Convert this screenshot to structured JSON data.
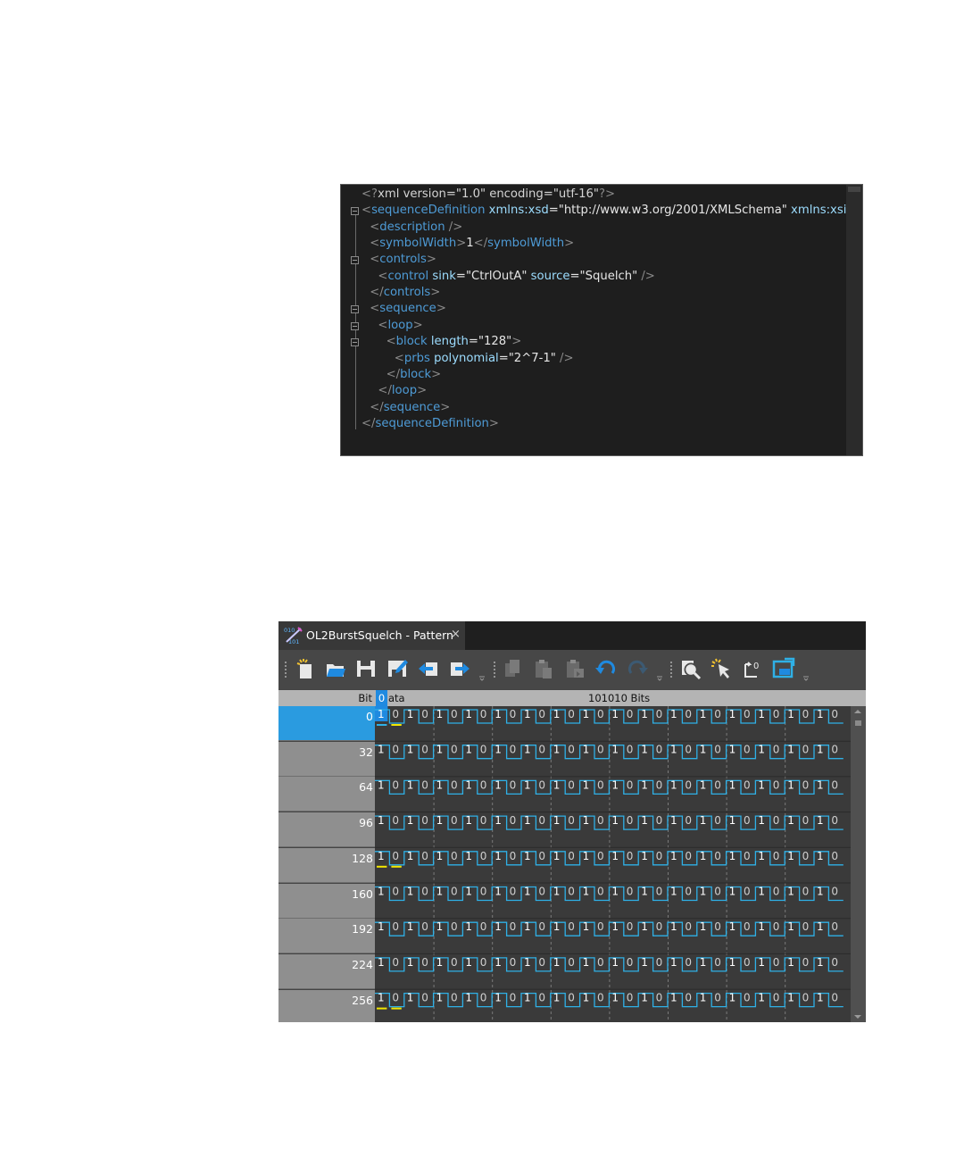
{
  "xml_editor": {
    "lines": [
      {
        "fold": false,
        "indent": 0,
        "tokens": [
          [
            "punc",
            "<?"
          ],
          [
            "pi",
            "xml version=\"1.0\" encoding=\"utf-16\""
          ],
          [
            "punc",
            "?>"
          ]
        ]
      },
      {
        "fold": true,
        "indent": 0,
        "tokens": [
          [
            "punc",
            "<"
          ],
          [
            "tag",
            "sequenceDefinition"
          ],
          [
            "attr",
            " xmlns:xsd"
          ],
          [
            "val",
            "=\"http://www.w3.org/2001/XMLSchema\""
          ],
          [
            "attr",
            " xmlns:xsi"
          ]
        ]
      },
      {
        "fold": false,
        "indent": 1,
        "tokens": [
          [
            "punc",
            "<"
          ],
          [
            "tag",
            "description"
          ],
          [
            "punc",
            " />"
          ]
        ]
      },
      {
        "fold": false,
        "indent": 1,
        "tokens": [
          [
            "punc",
            "<"
          ],
          [
            "tag",
            "symbolWidth"
          ],
          [
            "punc",
            ">"
          ],
          [
            "txt",
            "1"
          ],
          [
            "punc",
            "</"
          ],
          [
            "tag",
            "symbolWidth"
          ],
          [
            "punc",
            ">"
          ]
        ]
      },
      {
        "fold": true,
        "indent": 1,
        "tokens": [
          [
            "punc",
            "<"
          ],
          [
            "tag",
            "controls"
          ],
          [
            "punc",
            ">"
          ]
        ]
      },
      {
        "fold": false,
        "indent": 2,
        "tokens": [
          [
            "punc",
            "<"
          ],
          [
            "tag",
            "control"
          ],
          [
            "attr",
            " sink"
          ],
          [
            "val",
            "=\"CtrlOutA\""
          ],
          [
            "attr",
            " source"
          ],
          [
            "val",
            "=\"Squelch\""
          ],
          [
            "punc",
            " />"
          ]
        ]
      },
      {
        "fold": false,
        "indent": 1,
        "tokens": [
          [
            "punc",
            "</"
          ],
          [
            "tag",
            "controls"
          ],
          [
            "punc",
            ">"
          ]
        ]
      },
      {
        "fold": true,
        "indent": 1,
        "tokens": [
          [
            "punc",
            "<"
          ],
          [
            "tag",
            "sequence"
          ],
          [
            "punc",
            ">"
          ]
        ]
      },
      {
        "fold": true,
        "indent": 2,
        "tokens": [
          [
            "punc",
            "<"
          ],
          [
            "tag",
            "loop"
          ],
          [
            "punc",
            ">"
          ]
        ]
      },
      {
        "fold": true,
        "indent": 3,
        "tokens": [
          [
            "punc",
            "<"
          ],
          [
            "tag",
            "block"
          ],
          [
            "attr",
            " length"
          ],
          [
            "val",
            "=\"128\""
          ],
          [
            "punc",
            ">"
          ]
        ]
      },
      {
        "fold": false,
        "indent": 4,
        "tokens": [
          [
            "punc",
            "<"
          ],
          [
            "tag",
            "prbs"
          ],
          [
            "attr",
            " polynomial"
          ],
          [
            "val",
            "=\"2^7-1\""
          ],
          [
            "punc",
            " />"
          ]
        ]
      },
      {
        "fold": false,
        "indent": 3,
        "tokens": [
          [
            "punc",
            "</"
          ],
          [
            "tag",
            "block"
          ],
          [
            "punc",
            ">"
          ]
        ]
      },
      {
        "fold": false,
        "indent": 2,
        "tokens": [
          [
            "punc",
            "</"
          ],
          [
            "tag",
            "loop"
          ],
          [
            "punc",
            ">"
          ]
        ]
      },
      {
        "fold": false,
        "indent": 1,
        "tokens": [
          [
            "punc",
            "</"
          ],
          [
            "tag",
            "sequence"
          ],
          [
            "punc",
            ">"
          ]
        ]
      },
      {
        "fold": false,
        "indent": 0,
        "tokens": [
          [
            "punc",
            "</"
          ],
          [
            "tag",
            "sequenceDefinition"
          ],
          [
            "punc",
            ">"
          ]
        ]
      }
    ]
  },
  "pattern_editor": {
    "tab": {
      "title": "OL2BurstSquelch - Pattern",
      "close": "×",
      "icon": "pattern-file-icon"
    },
    "toolbar": {
      "buttons": [
        {
          "name": "new-icon",
          "enabled": true
        },
        {
          "name": "open-icon",
          "enabled": true
        },
        {
          "name": "save-icon",
          "enabled": true
        },
        {
          "name": "save-as-icon",
          "enabled": true
        },
        {
          "name": "import-icon",
          "enabled": true
        },
        {
          "name": "export-icon",
          "enabled": true
        },
        {
          "name": "copy-icon",
          "enabled": false
        },
        {
          "name": "paste-icon",
          "enabled": false
        },
        {
          "name": "paste-special-icon",
          "enabled": false
        },
        {
          "name": "undo-icon",
          "enabled": true
        },
        {
          "name": "redo-icon",
          "enabled": false
        },
        {
          "name": "find-icon",
          "enabled": true
        },
        {
          "name": "select-icon",
          "enabled": true
        },
        {
          "name": "goto-bit-icon",
          "enabled": true
        },
        {
          "name": "binary-view-icon",
          "enabled": true
        }
      ]
    },
    "header": {
      "bit_label": "Bit",
      "data_cursor": "0",
      "data_label": "ata",
      "bits_summary": "101010 Bits"
    },
    "rows": [
      {
        "offset": "0",
        "selected": true,
        "marks": [
          0,
          1
        ]
      },
      {
        "offset": "32",
        "selected": false,
        "marks": []
      },
      {
        "offset": "64",
        "selected": false,
        "marks": []
      },
      {
        "offset": "96",
        "selected": false,
        "marks": []
      },
      {
        "offset": "128",
        "selected": false,
        "marks": [
          0,
          1
        ]
      },
      {
        "offset": "160",
        "selected": false,
        "marks": []
      },
      {
        "offset": "192",
        "selected": false,
        "marks": []
      },
      {
        "offset": "224",
        "selected": false,
        "marks": []
      },
      {
        "offset": "256",
        "selected": false,
        "marks": [
          0,
          1
        ]
      }
    ],
    "row_bits": "10101010101010101010101010101010",
    "colors": {
      "waveform": "#2fb0e6",
      "selection": "#1f8ae0",
      "marker": "#f2e600",
      "cursor_underline": "#2fb0e6"
    }
  }
}
